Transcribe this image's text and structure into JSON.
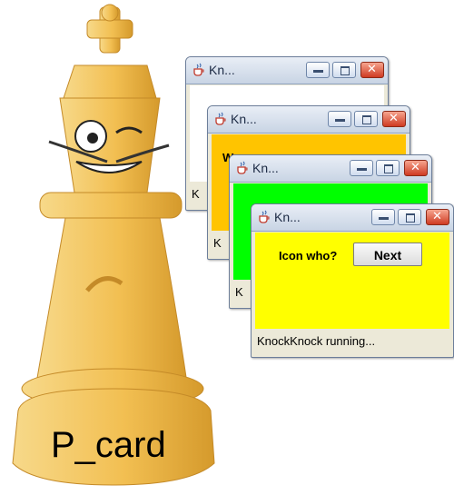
{
  "caption": "P_card",
  "windows": [
    {
      "title": "Kn...",
      "content_color": "#ffffff",
      "content_text": "",
      "status": "K"
    },
    {
      "title": "Kn...",
      "content_color": "#ffc400",
      "content_text": "W",
      "status": "K"
    },
    {
      "title": "Kn...",
      "content_color": "#00ff00",
      "content_text": "",
      "status": "K"
    },
    {
      "title": "Kn...",
      "content_color": "#ffff00",
      "content_text": "Icon who?",
      "button": "Next",
      "status": "KnockKnock running..."
    }
  ],
  "icons": {
    "app": "java-cup-icon",
    "minimize": "minimize-icon",
    "maximize": "maximize-icon",
    "close": "close-icon"
  }
}
